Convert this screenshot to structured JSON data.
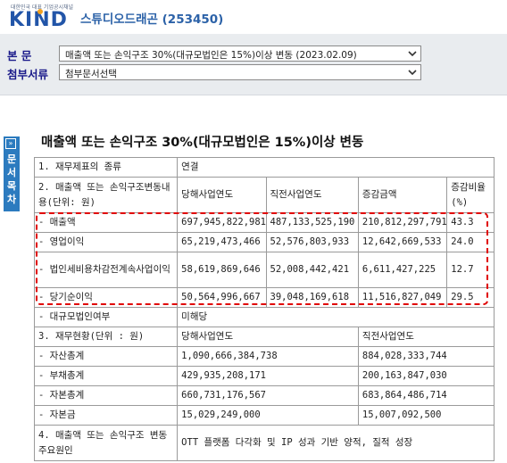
{
  "header": {
    "logo_tagline": "대한민국 대표 기업공시채널",
    "logo_text": "KIND",
    "company": "스튜디오드래곤 (253450)"
  },
  "filters": {
    "main_label": "본 문",
    "main_value": "매출액 또는 손익구조 30%(대규모법인은 15%)이상 변동 (2023.02.09)",
    "attach_label": "첨부서류",
    "attach_value": "첨부문서선택"
  },
  "sidetab": {
    "label": "문서목차",
    "arrow": "»"
  },
  "document": {
    "title": "매출액 또는 손익구조 30%(대규모법인은 15%)이상 변동",
    "rows": {
      "r1_label": "1. 재무제표의 종류",
      "r1_value": "연결",
      "r2_label": "2. 매출액 또는 손익구조변동내용(단위: 원)",
      "col_cur": "당해사업연도",
      "col_prev": "직전사업연도",
      "col_diff": "증감금액",
      "col_rate": "증감비율(%)",
      "sales_label": "- 매출액",
      "sales_cur": "697,945,822,981",
      "sales_prev": "487,133,525,190",
      "sales_diff": "210,812,297,791",
      "sales_rate": "43.3",
      "op_label": "- 영업이익",
      "op_cur": "65,219,473,466",
      "op_prev": "52,576,803,933",
      "op_diff": "12,642,669,533",
      "op_rate": "24.0",
      "pretax_label": "- 법인세비용차감전계속사업이익",
      "pretax_cur": "58,619,869,646",
      "pretax_prev": "52,008,442,421",
      "pretax_diff": "6,611,427,225",
      "pretax_rate": "12.7",
      "net_label": "- 당기순이익",
      "net_cur": "50,564,996,667",
      "net_prev": "39,048,169,618",
      "net_diff": "11,516,827,049",
      "net_rate": "29.5",
      "large_label": "- 대규모법인여부",
      "large_value": "미해당",
      "r3_label": "3. 재무현황(단위 : 원)",
      "r3_cur": "당해사업연도",
      "r3_prev": "직전사업연도",
      "assets_label": "- 자산총계",
      "assets_cur": "1,090,666,384,738",
      "assets_prev": "884,028,333,744",
      "liab_label": "- 부채총계",
      "liab_cur": "429,935,208,171",
      "liab_prev": "200,163,847,030",
      "equity_label": "- 자본총계",
      "equity_cur": "660,731,176,567",
      "equity_prev": "683,864,486,714",
      "capital_label": "- 자본금",
      "capital_cur": "15,029,249,000",
      "capital_prev": "15,007,092,500",
      "r4_label": "4. 매출액 또는 손익구조 변동 주요원인",
      "r4_value": "OTT 플랫폼 다각화 및 IP 성과 기반 양적, 질적 성장"
    }
  }
}
